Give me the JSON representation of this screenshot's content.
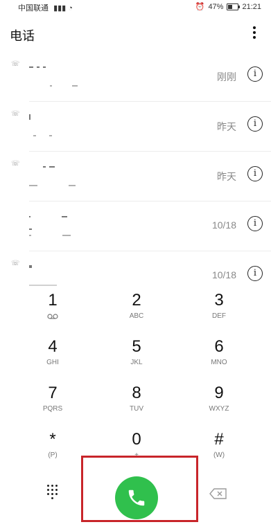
{
  "status_bar": {
    "carrier": "中国联通",
    "alarm": "⏰",
    "battery": "47%",
    "time": "21:21"
  },
  "header": {
    "title": "电话"
  },
  "calls": [
    {
      "time": "刚刚"
    },
    {
      "time": "昨天"
    },
    {
      "time": "昨天"
    },
    {
      "time": "10/18"
    },
    {
      "time": "10/18"
    }
  ],
  "dialpad": {
    "keys": [
      {
        "digit": "1",
        "letters": ""
      },
      {
        "digit": "2",
        "letters": "ABC"
      },
      {
        "digit": "3",
        "letters": "DEF"
      },
      {
        "digit": "4",
        "letters": "GHI"
      },
      {
        "digit": "5",
        "letters": "JKL"
      },
      {
        "digit": "6",
        "letters": "MNO"
      },
      {
        "digit": "7",
        "letters": "PQRS"
      },
      {
        "digit": "8",
        "letters": "TUV"
      },
      {
        "digit": "9",
        "letters": "WXYZ"
      },
      {
        "digit": "*",
        "letters": "(P)"
      },
      {
        "digit": "0",
        "letters": "+"
      },
      {
        "digit": "#",
        "letters": "(W)"
      }
    ]
  },
  "colors": {
    "call_button": "#30c04d",
    "highlight_box": "#c8252a"
  },
  "icons": {
    "more": "more-vert-icon",
    "call_type": "outgoing-call-icon",
    "info": "info-icon",
    "voicemail": "voicemail-icon",
    "dialpad": "dialpad-icon",
    "call": "phone-icon",
    "backspace": "backspace-icon"
  }
}
